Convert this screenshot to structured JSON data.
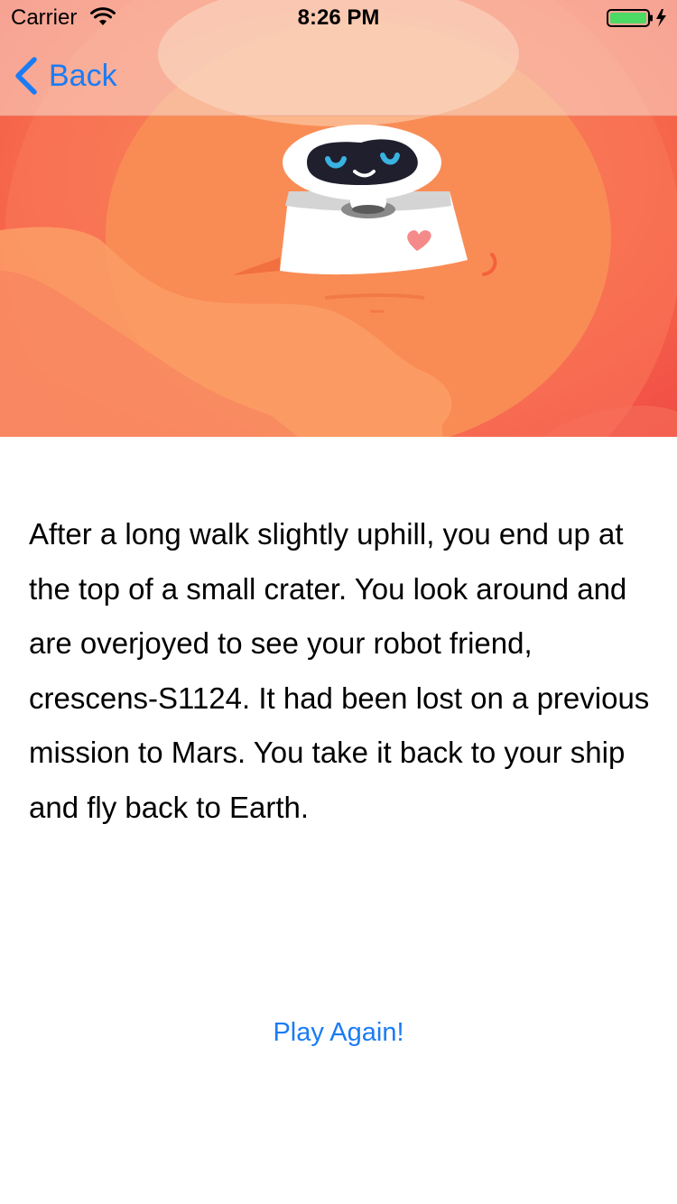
{
  "status_bar": {
    "carrier": "Carrier",
    "wifi_icon": "wifi-icon",
    "time": "8:26 PM",
    "battery_icon": "battery-charging-icon",
    "battery_color": "#4cd964"
  },
  "nav": {
    "back_icon": "chevron-left-icon",
    "back_label": "Back",
    "tint_color": "#1a7cf5"
  },
  "hero": {
    "image": "mars-robot-illustration"
  },
  "story": {
    "text": "After a long walk slightly uphill, you end up at the top of a small crater. You look around and are overjoyed to see your robot friend, crescens-S1124. It had been lost on a previous mission to Mars. You take it back to your ship and fly back to Earth."
  },
  "actions": {
    "play_again_label": "Play Again!"
  }
}
